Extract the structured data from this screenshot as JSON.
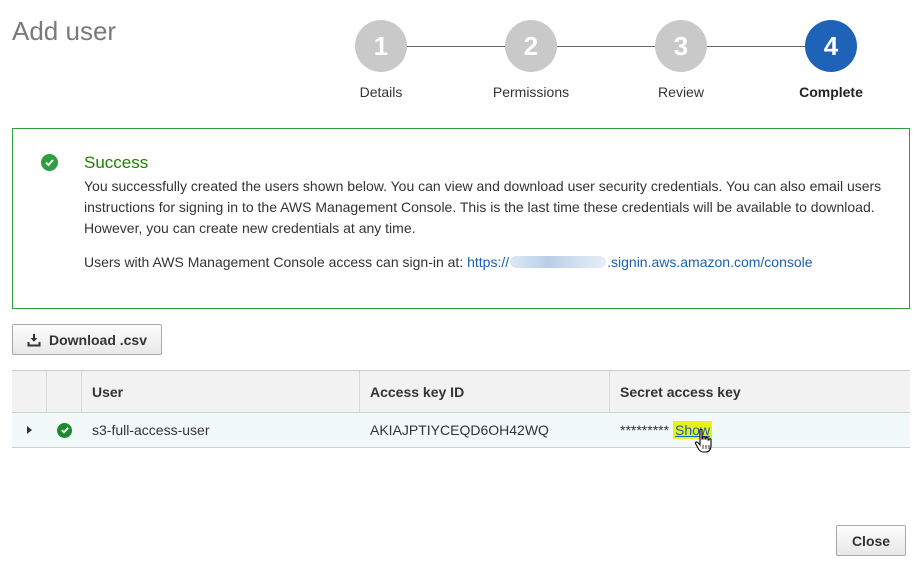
{
  "page": {
    "title": "Add user"
  },
  "stepper": {
    "steps": [
      {
        "number": "1",
        "label": "Details"
      },
      {
        "number": "2",
        "label": "Permissions"
      },
      {
        "number": "3",
        "label": "Review"
      },
      {
        "number": "4",
        "label": "Complete"
      }
    ],
    "active_step": 4
  },
  "success": {
    "title": "Success",
    "message": "You successfully created the users shown below. You can view and download user security credentials. You can also email users instructions for signing in to the AWS Management Console. This is the last time these credentials will be available to download. However, you can create new credentials at any time.",
    "signin_prefix": "Users with AWS Management Console access can sign-in at:",
    "signin_url_start": "https://",
    "signin_url_end": ".signin.aws.amazon.com/console"
  },
  "toolbar": {
    "download_label": "Download .csv"
  },
  "table": {
    "columns": [
      "User",
      "Access key ID",
      "Secret access key"
    ],
    "rows": [
      {
        "user": "s3-full-access-user",
        "access_key_id": "AKIAJPTIYCEQD6OH42WQ",
        "secret_masked": "*********",
        "show_label": "Show"
      }
    ]
  },
  "footer": {
    "close_label": "Close"
  },
  "colors": {
    "success_green": "#1d8102",
    "active_step_blue": "#1f63b8",
    "inactive_step_gray": "#c9c9c9",
    "link_blue": "#1a5fb4",
    "highlight_yellow": "#e8f21a"
  }
}
